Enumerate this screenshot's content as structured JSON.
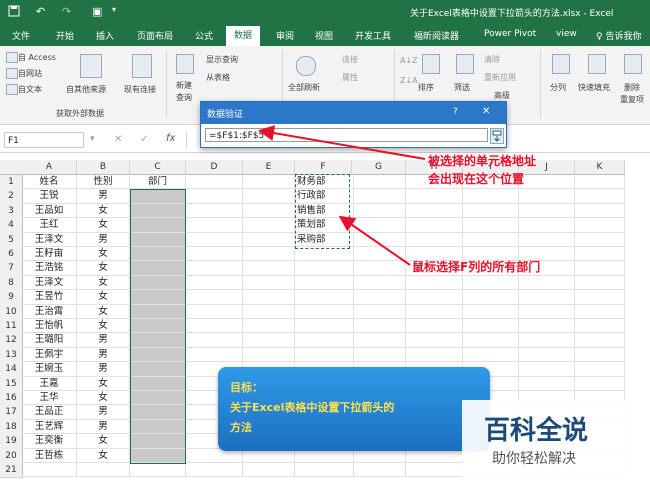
{
  "window": {
    "title": "关于Excel表格中设置下拉箭头的方法.xlsx - Excel",
    "save_icon": "save-icon",
    "undo_icon": "undo-icon",
    "redo_icon": "redo-icon"
  },
  "tabs": [
    "文件",
    "开始",
    "插入",
    "页面布局",
    "公式",
    "数据",
    "审阅",
    "视图",
    "开发工具",
    "福昕阅读器",
    "Power Pivot",
    "view",
    "♀ 告诉我你"
  ],
  "active_tab": "数据",
  "ribbon": {
    "get_external": [
      "自 Access",
      "自网站",
      "自文本"
    ],
    "other_sources": "自其他来源",
    "existing_conn": "现有连接",
    "new_query": "新建",
    "new_query2": "查询",
    "show_query": "显示查询",
    "from_table": "从表格",
    "recent_sources": "最近使用的源",
    "refresh_all": "全部刷新",
    "connections": "连接",
    "properties": "属性",
    "edit_links": "编辑链接",
    "sort": "排序",
    "filter": "筛选",
    "clear": "清除",
    "reapply": "重新应用",
    "advanced": "高级",
    "split": "分列",
    "flash_fill": "快速填充",
    "remove_dup": "删除",
    "remove_dup2": "重复项",
    "group_label": "获取外部数据"
  },
  "formula_bar": {
    "name_box": "F1",
    "cancel": "✕",
    "enter": "✓",
    "fx": "fx"
  },
  "dialog": {
    "title": "数据验证",
    "help": "?",
    "close": "✕",
    "input_value": "=$F$1:$F$5"
  },
  "columns": [
    "A",
    "B",
    "C",
    "D",
    "E",
    "F",
    "G",
    "H",
    "I",
    "J",
    "K"
  ],
  "rows": [
    {
      "n": "1",
      "a": "姓名",
      "b": "性别",
      "c": "部门",
      "f": "财务部"
    },
    {
      "n": "2",
      "a": "王锐",
      "b": "男",
      "c": "",
      "f": "行政部"
    },
    {
      "n": "3",
      "a": "王品如",
      "b": "女",
      "c": "",
      "f": "销售部"
    },
    {
      "n": "4",
      "a": "王红",
      "b": "女",
      "c": "",
      "f": "策划部"
    },
    {
      "n": "5",
      "a": "王泽文",
      "b": "男",
      "c": "",
      "f": "采购部"
    },
    {
      "n": "6",
      "a": "王籽亩",
      "b": "女",
      "c": "",
      "f": ""
    },
    {
      "n": "7",
      "a": "王浩铭",
      "b": "女",
      "c": "",
      "f": ""
    },
    {
      "n": "8",
      "a": "王泽文",
      "b": "女",
      "c": "",
      "f": ""
    },
    {
      "n": "9",
      "a": "王昱竹",
      "b": "女",
      "c": "",
      "f": ""
    },
    {
      "n": "10",
      "a": "王治霄",
      "b": "女",
      "c": "",
      "f": ""
    },
    {
      "n": "11",
      "a": "王怡帆",
      "b": "女",
      "c": "",
      "f": ""
    },
    {
      "n": "12",
      "a": "王璐阳",
      "b": "男",
      "c": "",
      "f": ""
    },
    {
      "n": "13",
      "a": "王佩宇",
      "b": "男",
      "c": "",
      "f": ""
    },
    {
      "n": "14",
      "a": "王婉玉",
      "b": "男",
      "c": "",
      "f": ""
    },
    {
      "n": "15",
      "a": "王嘉",
      "b": "女",
      "c": "",
      "f": ""
    },
    {
      "n": "16",
      "a": "王华",
      "b": "女",
      "c": "",
      "f": ""
    },
    {
      "n": "17",
      "a": "王品正",
      "b": "男",
      "c": "",
      "f": ""
    },
    {
      "n": "18",
      "a": "王艺辉",
      "b": "男",
      "c": "",
      "f": ""
    },
    {
      "n": "19",
      "a": "王奕衡",
      "b": "女",
      "c": "",
      "f": ""
    },
    {
      "n": "20",
      "a": "王哲栋",
      "b": "女",
      "c": "",
      "f": ""
    },
    {
      "n": "21",
      "a": "",
      "b": "",
      "c": "",
      "f": ""
    }
  ],
  "annotations": {
    "note1_line1": "被选择的单元格地址",
    "note1_line2": "会出现在这个位置",
    "note2": "鼠标选择F列的所有部门",
    "goal_title": "目标：",
    "goal_line1": "关于Excel表格中设置下拉箭头的",
    "goal_line2": "方法",
    "arrow_color": "#e8102b"
  },
  "watermark": {
    "brand": "百科全说",
    "slogan": "助你轻松解决"
  }
}
